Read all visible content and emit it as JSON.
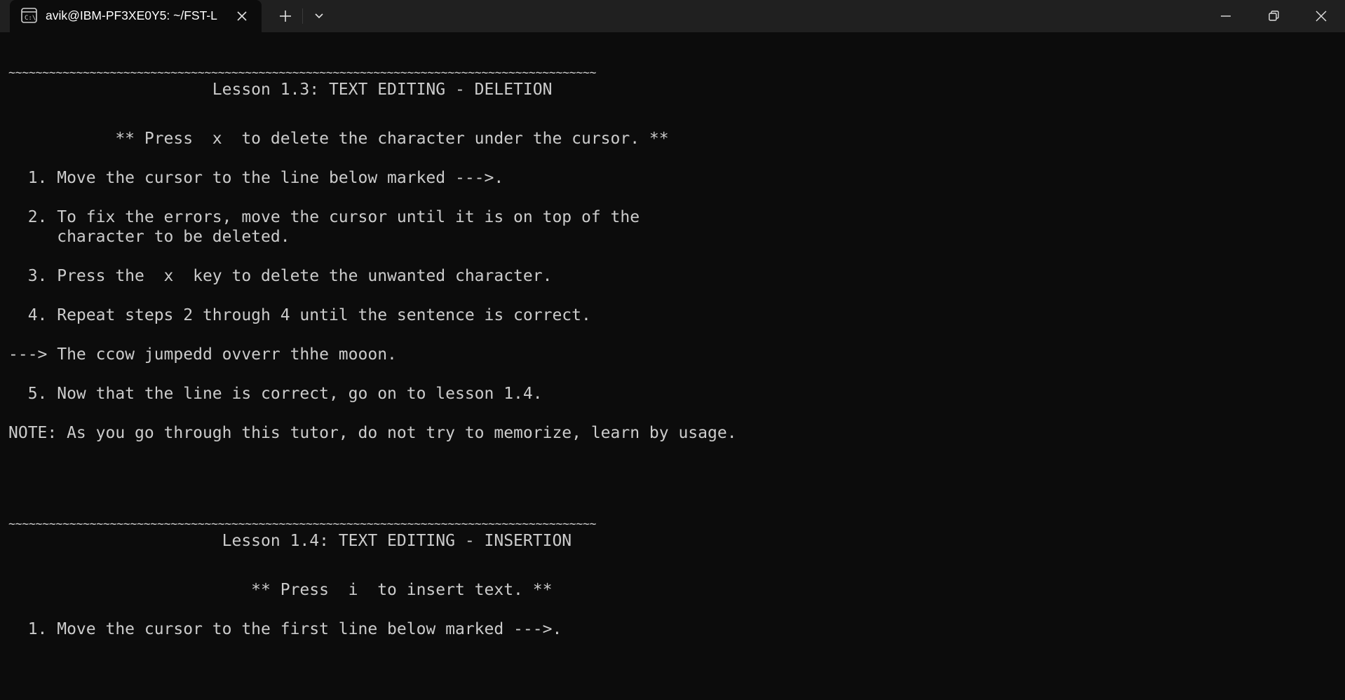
{
  "window": {
    "tab_title": "avik@IBM-PF3XE0Y5: ~/FST-L",
    "new_tab_icon": "plus-icon",
    "dropdown_icon": "chevron-down-icon",
    "close_tab_icon": "close-icon",
    "controls": [
      "minimize-icon",
      "restore-icon",
      "close-icon"
    ]
  },
  "terminal": {
    "lines": [
      "~~~~~~~~~~~~~~~~~~~~~~~~~~~~~~~~~~~~~~~~~~~~~~~~~~~~~~~~~~~~~~~~~~~~~~~~~~~~~~~~~~~~~~~",
      "                     Lesson 1.3: TEXT EDITING - DELETION",
      "",
      "",
      "           ** Press  x  to delete the character under the cursor. **",
      "",
      "  1. Move the cursor to the line below marked --->.",
      "",
      "  2. To fix the errors, move the cursor until it is on top of the",
      "     character to be deleted.",
      "",
      "  3. Press the  x  key to delete the unwanted character.",
      "",
      "  4. Repeat steps 2 through 4 until the sentence is correct.",
      "",
      "---> The ccow jumpedd ovverr thhe mooon.",
      "",
      "  5. Now that the line is correct, go on to lesson 1.4.",
      "",
      "NOTE: As you go through this tutor, do not try to memorize, learn by usage.",
      "",
      "",
      "",
      "~~~~~~~~~~~~~~~~~~~~~~~~~~~~~~~~~~~~~~~~~~~~~~~~~~~~~~~~~~~~~~~~~~~~~~~~~~~~~~~~~~~~~~~",
      "                      Lesson 1.4: TEXT EDITING - INSERTION",
      "",
      "",
      "                         ** Press  i  to insert text. **",
      "",
      "  1. Move the cursor to the first line below marked --->."
    ]
  },
  "colors": {
    "background": "#0c0c0c",
    "titlebar": "#202020",
    "text": "#cccccc"
  }
}
